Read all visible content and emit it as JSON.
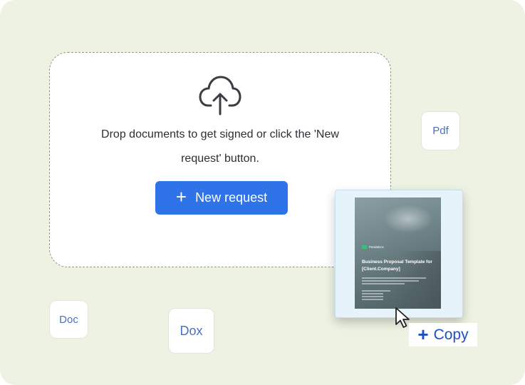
{
  "dropzone": {
    "icon": "cloud-upload-icon",
    "instruction": "Drop documents to get signed or click the 'New request' button.",
    "button_icon": "plus-icon",
    "button_label": "New request"
  },
  "file_types": {
    "pdf": "Pdf",
    "doc": "Doc",
    "dox": "Dox"
  },
  "drag_preview": {
    "logo_text": "PandaDoc",
    "title": "Business Proposal Template for [Client.Company]"
  },
  "copy_tooltip": {
    "icon": "plus-icon",
    "label": "Copy"
  },
  "colors": {
    "background": "#eef2e3",
    "primary": "#2f73e8",
    "chip_text": "#4b6fc6",
    "copy_text": "#1f4fc4"
  }
}
